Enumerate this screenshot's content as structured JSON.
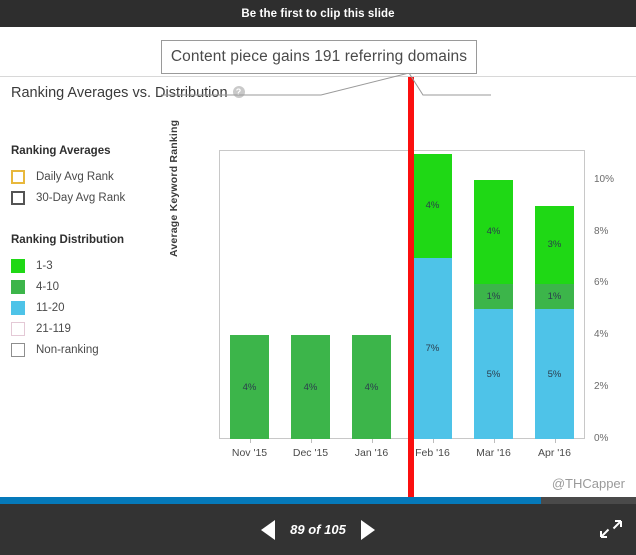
{
  "clip_bar": {
    "label": "Be the first to clip this slide"
  },
  "annotation": {
    "text": "Content piece gains 191 referring domains"
  },
  "card": {
    "title": "Ranking Averages vs. Distribution",
    "help_icon": "help-icon",
    "watermark": "@THCapper"
  },
  "legend": {
    "averages_heading": "Ranking Averages",
    "averages_items": [
      {
        "label": "Daily Avg Rank",
        "fill": "#ffffff",
        "border": "#e8b83c"
      },
      {
        "label": "30-Day Avg Rank",
        "fill": "#ffffff",
        "border": "#545454"
      }
    ],
    "distribution_heading": "Ranking Distribution",
    "distribution_items": [
      {
        "label": "1-3",
        "fill": "#1fd815",
        "border": "#1fd815"
      },
      {
        "label": "4-10",
        "fill": "#3cb54a",
        "border": "#3cb54a"
      },
      {
        "label": "11-20",
        "fill": "#4ec3e8",
        "border": "#4ec3e8"
      },
      {
        "label": "21-119",
        "fill": "#ffffff",
        "border": "#e4c9d6"
      },
      {
        "label": "Non-ranking",
        "fill": "#ffffff",
        "border": "#8e8e8e"
      }
    ]
  },
  "chart_data": {
    "type": "bar",
    "subtype": "stacked",
    "title": "Ranking Averages vs. Distribution",
    "xlabel": "",
    "ylabel": "Average Keyword Ranking",
    "ylim": [
      0,
      11.15
    ],
    "ytick_labels": [
      "0%",
      "2%",
      "4%",
      "6%",
      "8%",
      "10%"
    ],
    "ytick_values": [
      0,
      2,
      4,
      6,
      8,
      10
    ],
    "grid": false,
    "legend_position": "left",
    "categories": [
      "Nov '15",
      "Dec '15",
      "Jan '16",
      "Feb '16",
      "Mar '16",
      "Apr '16"
    ],
    "series": [
      {
        "name": "11-20",
        "color": "#4ec3e8",
        "values": [
          0,
          0,
          0,
          7,
          5,
          5
        ],
        "labels": [
          "",
          "",
          "",
          "7%",
          "5%",
          "5%"
        ]
      },
      {
        "name": "4-10",
        "color": "#3cb54a",
        "values": [
          4,
          4,
          4,
          0,
          1,
          1
        ],
        "labels": [
          "4%",
          "4%",
          "4%",
          "",
          "1%",
          "1%"
        ]
      },
      {
        "name": "1-3",
        "color": "#1fd815",
        "values": [
          0,
          0,
          0,
          4,
          4,
          3
        ],
        "labels": [
          "",
          "",
          "",
          "4%",
          "4%",
          "3%"
        ]
      }
    ],
    "annotation": {
      "text": "Content piece gains 191 referring domains",
      "marker_category": "Feb '16",
      "marker_color": "#fb0f0f"
    }
  },
  "navigation": {
    "prev_icon": "triangle-left-icon",
    "next_icon": "triangle-right-icon",
    "counter": "89 of 105",
    "fullscreen_icon": "fullscreen-expand-icon",
    "progress_percent": 85
  }
}
